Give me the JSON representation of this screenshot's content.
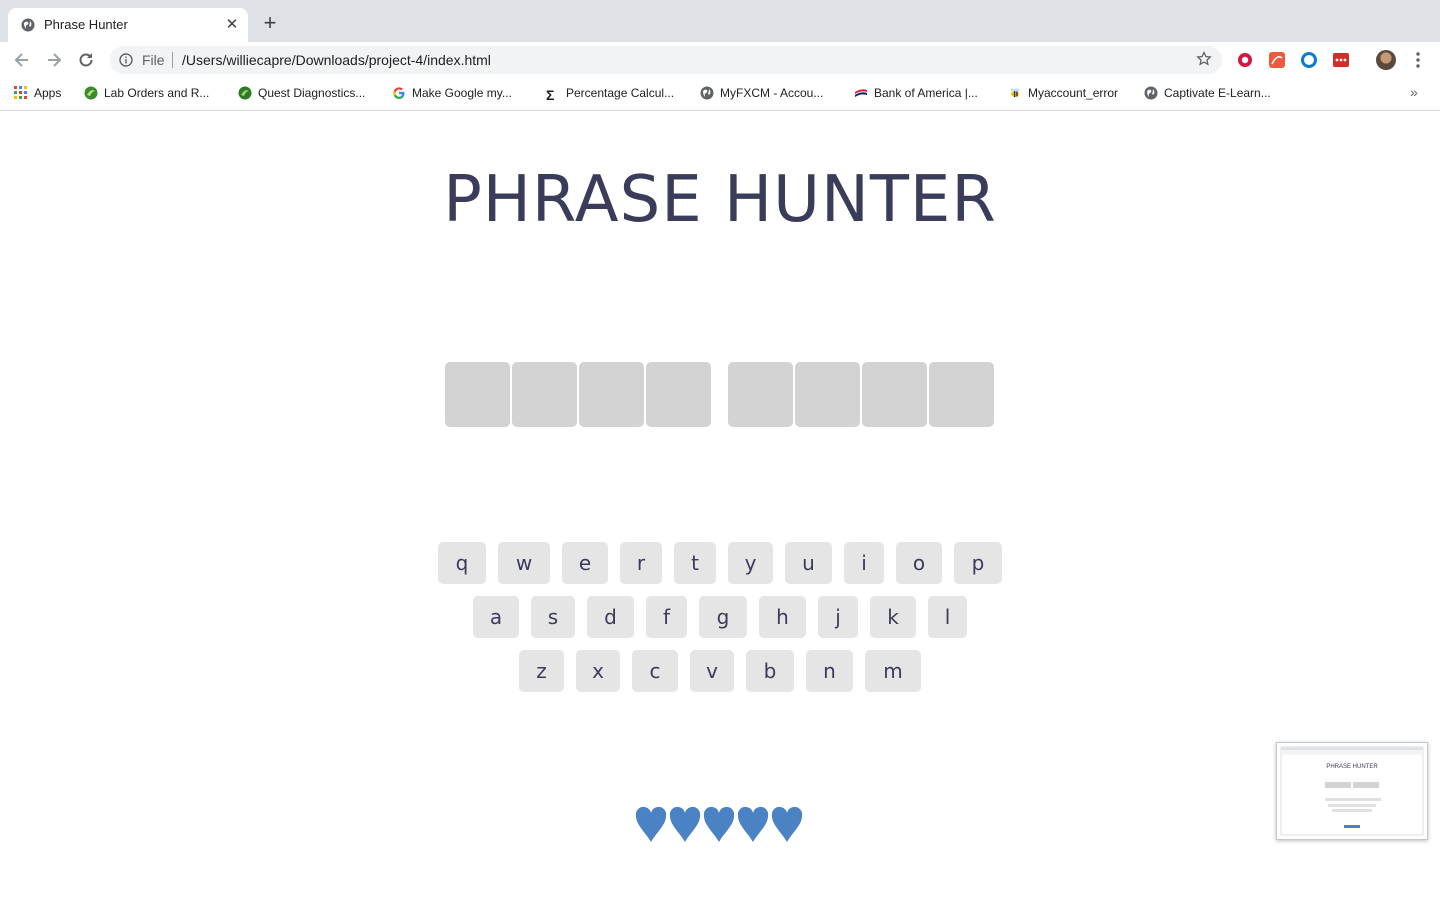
{
  "browser": {
    "tab": {
      "title": "Phrase Hunter",
      "close_icon": "close-icon"
    },
    "new_tab_icon": "plus-icon",
    "omnibox": {
      "scheme_label": "File",
      "url": "/Users/williecapre/Downloads/project-4/index.html"
    },
    "bookmarks": [
      {
        "label": "Apps",
        "icon": "apps-grid-icon"
      },
      {
        "label": "Lab Orders and R...",
        "icon": "quest-logo-icon"
      },
      {
        "label": "Quest Diagnostics...",
        "icon": "quest-logo-icon"
      },
      {
        "label": "Make Google my...",
        "icon": "google-g-icon"
      },
      {
        "label": "Percentage Calcul...",
        "icon": "sigma-icon"
      },
      {
        "label": "MyFXCM - Accou...",
        "icon": "globe-icon"
      },
      {
        "label": "Bank of America |...",
        "icon": "bank-flag-icon"
      },
      {
        "label": "Myaccount_error",
        "icon": "bee-icon"
      },
      {
        "label": "Captivate E-Learn...",
        "icon": "globe-icon"
      }
    ],
    "more_bookmarks_icon": "double-chevron-right-icon"
  },
  "game": {
    "title": "PHRASE HUNTER",
    "phrase_words": [
      4,
      4
    ],
    "keyboard": {
      "rows": [
        [
          "q",
          "w",
          "e",
          "r",
          "t",
          "y",
          "u",
          "i",
          "o",
          "p"
        ],
        [
          "a",
          "s",
          "d",
          "f",
          "g",
          "h",
          "j",
          "k",
          "l"
        ],
        [
          "z",
          "x",
          "c",
          "v",
          "b",
          "n",
          "m"
        ]
      ]
    },
    "lives": {
      "remaining": 5,
      "total": 5,
      "icon": "heart-icon",
      "color": "#4a82c3"
    },
    "colors": {
      "title": "#3a3c5a",
      "letter_box": "#d3d3d3",
      "key_bg": "#e5e5e5"
    }
  },
  "thumbnail": {
    "title": "PHRASE HUNTER"
  }
}
